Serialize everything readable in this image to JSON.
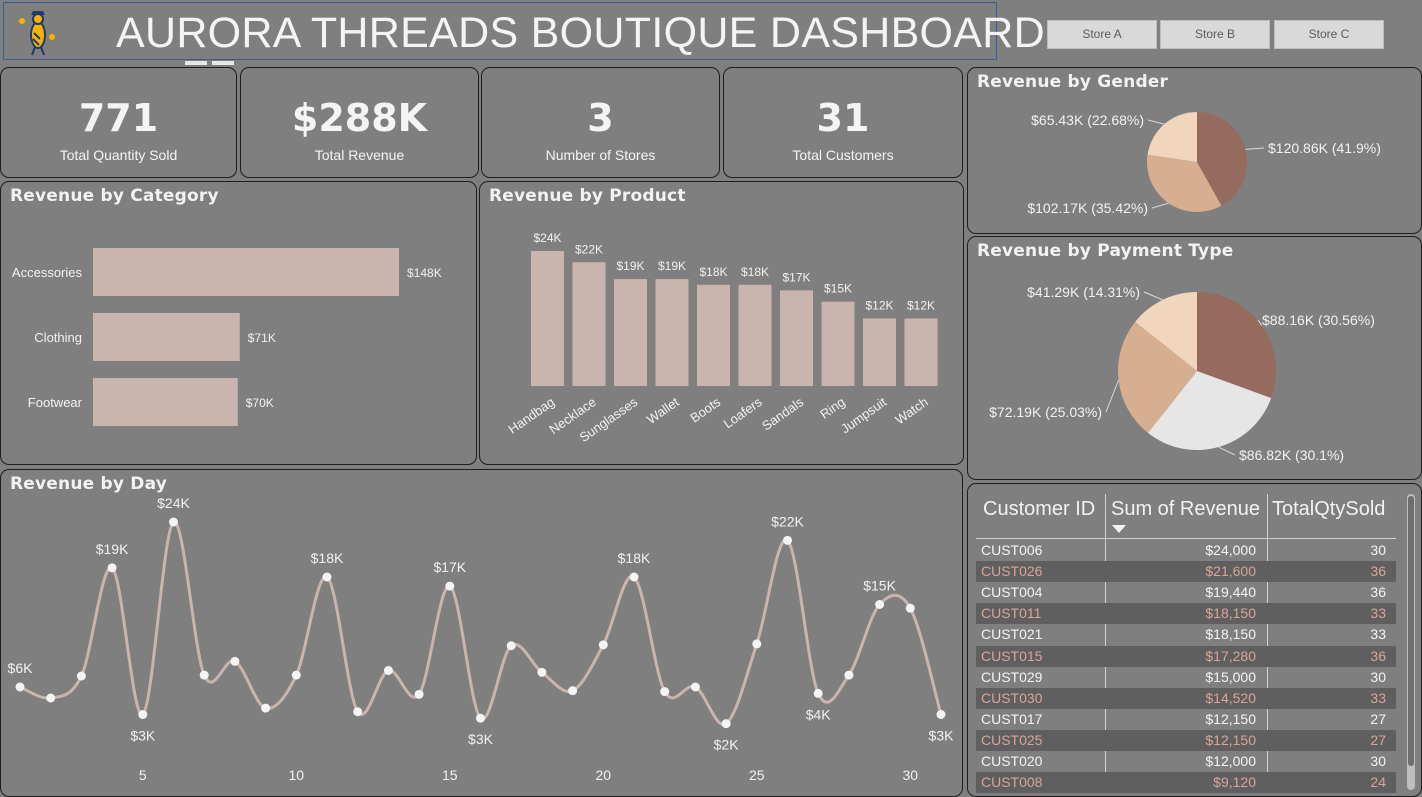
{
  "header": {
    "title": "AURORA THREADS BOUTIQUE DASHBOARD",
    "logo_icon": "bird-logo-icon",
    "stores": [
      "Store A",
      "Store B",
      "Store C"
    ]
  },
  "kpis": [
    {
      "value": "771",
      "label": "Total Quantity Sold"
    },
    {
      "value": "$288K",
      "label": "Total Revenue"
    },
    {
      "value": "3",
      "label": "Number of Stores"
    },
    {
      "value": "31",
      "label": "Total Customers"
    }
  ],
  "colors": {
    "bar": "#c9b5ae",
    "line": "#c9b5ae",
    "pie_dark": "#946b5d",
    "pie_mid": "#d6ae90",
    "pie_light": "#f1d5bd",
    "pie_white": "#e6e6e6",
    "table_alt_text": "#d9a59b"
  },
  "chart_data": [
    {
      "id": "category",
      "type": "bar",
      "orientation": "horizontal",
      "title": "Revenue by Category",
      "categories": [
        "Accessories",
        "Clothing",
        "Footwear"
      ],
      "values": [
        148,
        71,
        70
      ],
      "labels": [
        "$148K",
        "$71K",
        "$70K"
      ],
      "unit": "K"
    },
    {
      "id": "product",
      "type": "bar",
      "title": "Revenue by Product",
      "categories": [
        "Handbag",
        "Necklace",
        "Sunglasses",
        "Wallet",
        "Boots",
        "Loafers",
        "Sandals",
        "Ring",
        "Jumpsuit",
        "Watch"
      ],
      "values": [
        24,
        22,
        19,
        19,
        18,
        18,
        17,
        15,
        12,
        12
      ],
      "labels": [
        "$24K",
        "$22K",
        "$19K",
        "$19K",
        "$18K",
        "$18K",
        "$17K",
        "$15K",
        "$12K",
        "$12K"
      ]
    },
    {
      "id": "day",
      "type": "line",
      "title": "Revenue by Day",
      "x": [
        1,
        2,
        3,
        4,
        5,
        6,
        7,
        8,
        9,
        10,
        11,
        12,
        13,
        14,
        15,
        16,
        17,
        18,
        19,
        20,
        21,
        22,
        23,
        24,
        25,
        26,
        27,
        28,
        29,
        30,
        31
      ],
      "values": [
        6,
        4.8,
        7.2,
        19,
        3,
        24,
        7.3,
        8.8,
        3.7,
        7.3,
        18,
        3.3,
        7.8,
        5.2,
        17,
        2.6,
        10.5,
        7.6,
        5.6,
        10.6,
        18,
        5.5,
        6,
        2,
        10.7,
        22,
        5.3,
        7.3,
        15,
        14.6,
        3
      ],
      "point_labels": {
        "1": "$6K",
        "4": "$19K",
        "5": "$3K",
        "6": "$24K",
        "11": "$18K",
        "15": "$17K",
        "16": "$3K",
        "21": "$18K",
        "24": "$2K",
        "26": "$22K",
        "27": "$4K",
        "29": "$15K",
        "31": "$3K"
      },
      "xticks": [
        5,
        10,
        15,
        20,
        25,
        30
      ]
    },
    {
      "id": "gender",
      "type": "pie",
      "title": "Revenue by Gender",
      "values": [
        120.86,
        102.17,
        65.43
      ],
      "labels": [
        "$120.86K (41.9%)",
        "$102.17K (35.42%)",
        "$65.43K (22.68%)"
      ]
    },
    {
      "id": "payment",
      "type": "pie",
      "title": "Revenue by Payment Type",
      "values": [
        88.16,
        86.82,
        72.19,
        41.29
      ],
      "labels": [
        "$88.16K (30.56%)",
        "$86.82K (30.1%)",
        "$72.19K (25.03%)",
        "$41.29K (14.31%)"
      ]
    },
    {
      "id": "customers",
      "type": "table",
      "columns": [
        "Customer ID",
        "Sum of Revenue",
        "TotalQtySold"
      ],
      "rows": [
        [
          "CUST006",
          "$24,000",
          "30"
        ],
        [
          "CUST026",
          "$21,600",
          "36"
        ],
        [
          "CUST004",
          "$19,440",
          "36"
        ],
        [
          "CUST011",
          "$18,150",
          "33"
        ],
        [
          "CUST021",
          "$18,150",
          "33"
        ],
        [
          "CUST015",
          "$17,280",
          "36"
        ],
        [
          "CUST029",
          "$15,000",
          "30"
        ],
        [
          "CUST030",
          "$14,520",
          "33"
        ],
        [
          "CUST017",
          "$12,150",
          "27"
        ],
        [
          "CUST025",
          "$12,150",
          "27"
        ],
        [
          "CUST020",
          "$12,000",
          "30"
        ],
        [
          "CUST008",
          "$9,120",
          "24"
        ]
      ]
    }
  ]
}
